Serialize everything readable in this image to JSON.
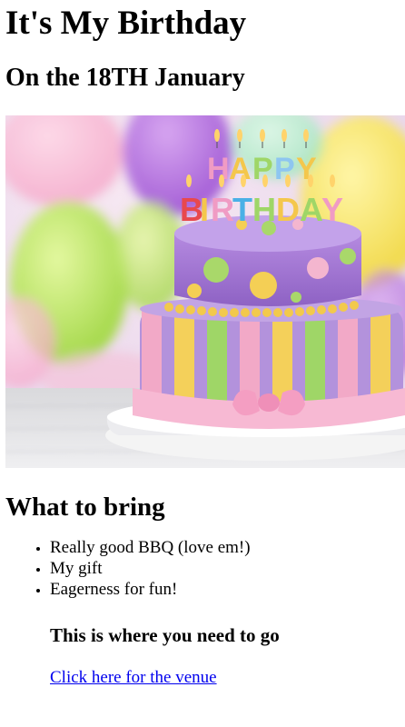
{
  "header": {
    "title": "It's My Birthday",
    "date_line": "On the 18TH January"
  },
  "hero": {
    "image_name": "birthday-cake-photo",
    "cake_topper_text_line1": "HAPPY",
    "cake_topper_text_line2": "BIRTHDAY"
  },
  "bring": {
    "heading": "What to bring",
    "items": [
      "Really good BBQ (love em!)",
      "My gift",
      "Eagerness for fun!"
    ]
  },
  "venue": {
    "heading": "This is where you need to go",
    "link_text": "Click here for the venue"
  },
  "colors": {
    "link": "#0000ee",
    "text": "#000000",
    "background": "#ffffff"
  }
}
